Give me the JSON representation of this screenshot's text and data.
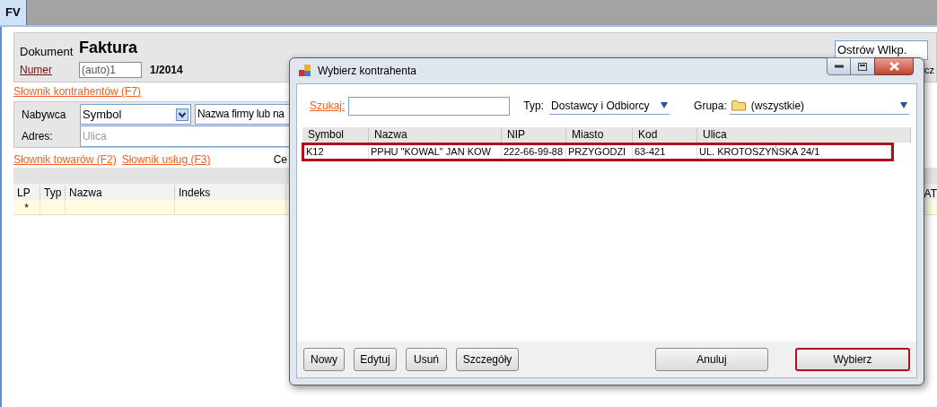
{
  "tab": {
    "label": "FV",
    "selected": true
  },
  "document": {
    "label": "Dokument",
    "type": "Faktura",
    "number_link": "Numer",
    "number_field": "(auto)1",
    "number": "1/2014",
    "city_field": "Ostrów Wlkp.",
    "cut_label": "cz"
  },
  "contractor_link": "Słownik kontrahentów (F7)",
  "buyer": {
    "label": "Nabywca",
    "select": "Symbol",
    "name_field": "Nazwa firmy lub na",
    "address_label": "Adres:",
    "street_placeholder": "Ulica"
  },
  "item_links": [
    "Słownik towarów (F2)",
    "Słownik usług (F3)"
  ],
  "cut_label": "Ce",
  "items_table": {
    "columns": [
      "LP",
      "Typ",
      "Nazwa",
      "Indeks"
    ],
    "cut_column": "AT",
    "new_row_marker": "*"
  },
  "dialog": {
    "title": "Wybierz kontrahenta",
    "search_label": "Szukaj:",
    "type_label": "Typ:",
    "type_value": "Dostawcy i Odbiorcy",
    "group_label": "Grupa:",
    "group_value": "(wszystkie)",
    "columns": [
      "Symbol",
      "Nazwa",
      "NIP",
      "Miasto",
      "Kod",
      "Ulica"
    ],
    "rows": [
      {
        "cells": [
          "K12",
          "PPHU \"KOWAL\" JAN KOW",
          "222-66-99-88",
          "PRZYGODZI",
          "63-421",
          "UL. KROTOSZYŃSKA 24/1"
        ],
        "selected": true
      }
    ],
    "left_buttons": [
      {
        "label": "Nowy",
        "focused": false
      },
      {
        "label": "Edytuj",
        "focused": false
      },
      {
        "label": "Usuń",
        "focused": false
      },
      {
        "label": "Szczegóły",
        "focused": false
      }
    ],
    "right_buttons": [
      {
        "label": "Anuluj",
        "focused": false
      },
      {
        "label": "Wybierz",
        "focused": true
      }
    ]
  }
}
